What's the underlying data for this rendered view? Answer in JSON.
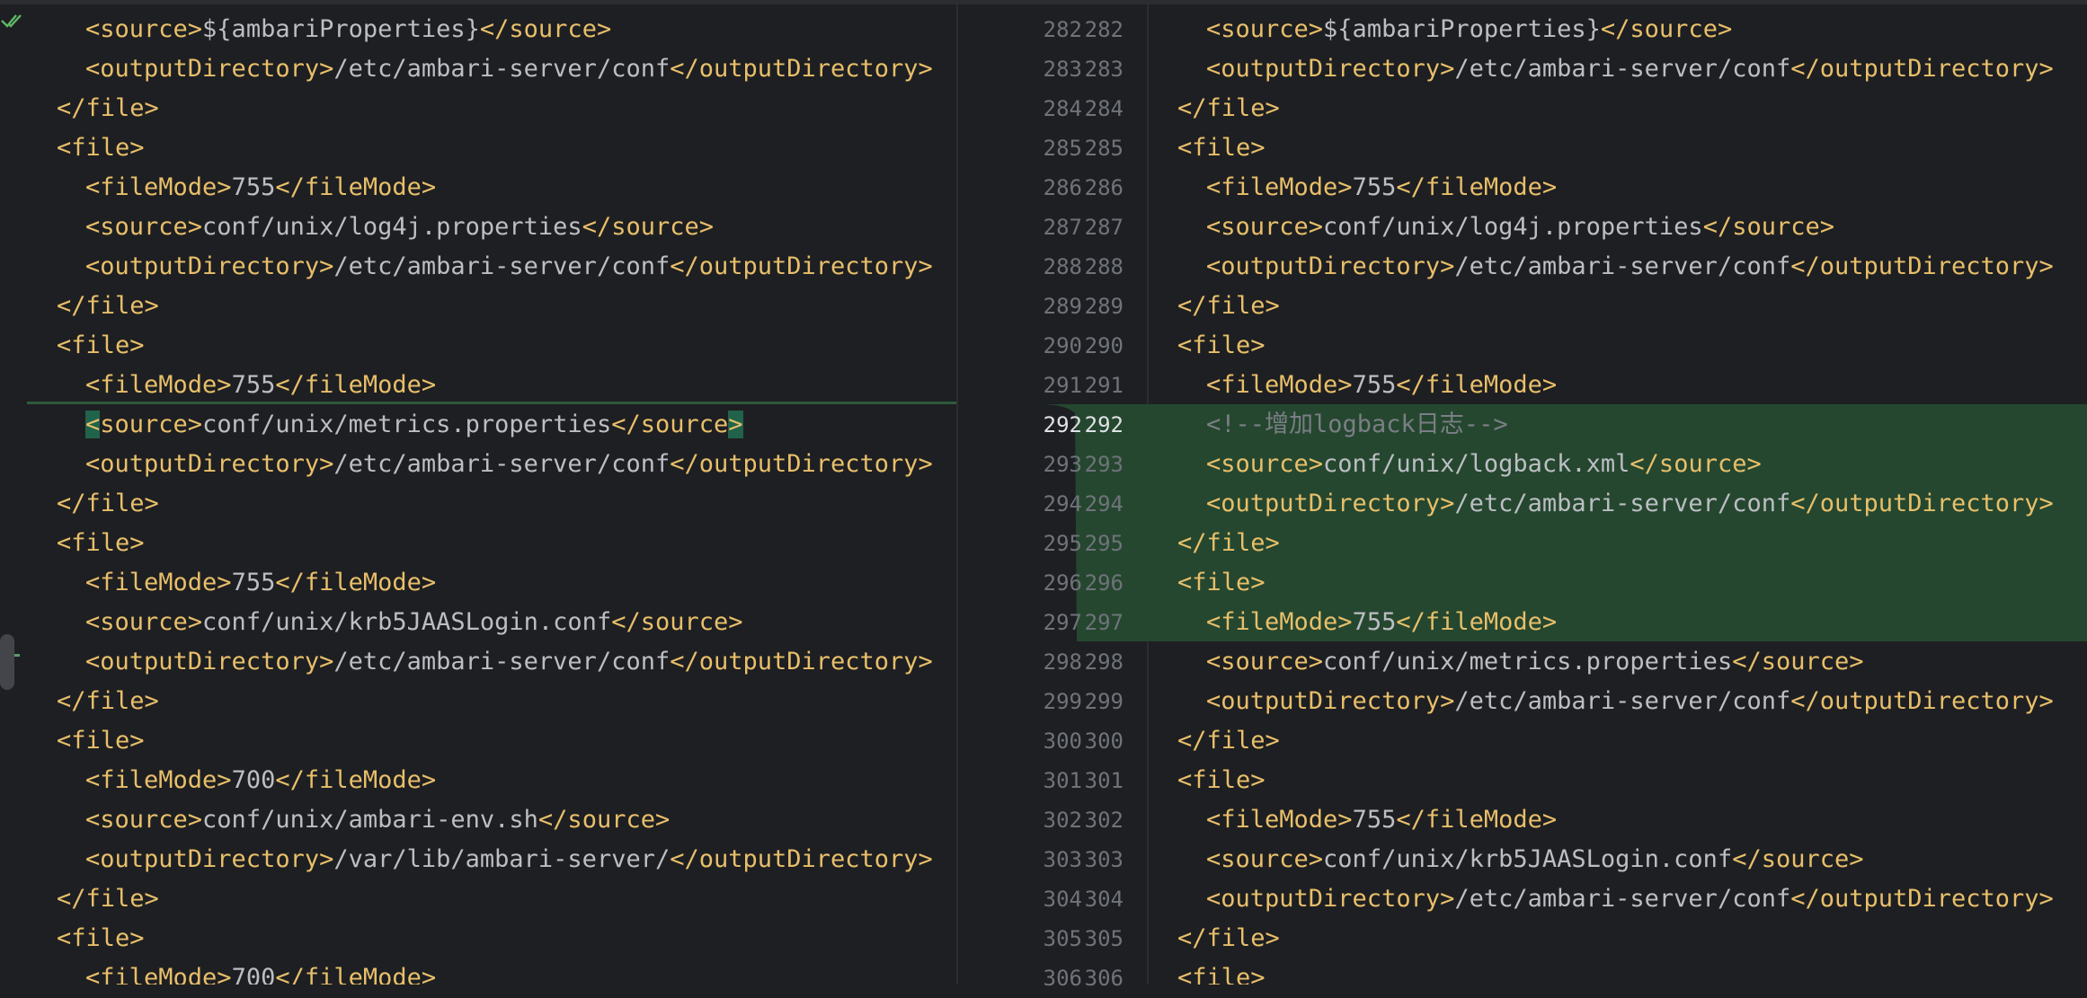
{
  "gutter": {
    "left_numbers": [
      "282",
      "283",
      "284",
      "285",
      "286",
      "287",
      "288",
      "289",
      "290",
      "291",
      "292",
      "293",
      "294",
      "295",
      "296",
      "297",
      "298",
      "299",
      "300",
      "301",
      "302",
      "303",
      "304",
      "305",
      "306"
    ],
    "right_numbers": [
      "282",
      "283",
      "284",
      "285",
      "286",
      "287",
      "288",
      "289",
      "290",
      "291",
      "292",
      "293",
      "294",
      "295",
      "296",
      "297",
      "298",
      "299",
      "300",
      "301",
      "302",
      "303",
      "304",
      "305",
      "306"
    ]
  },
  "left_pane": {
    "lines": [
      [
        {
          "t": "<source>",
          "c": "tag"
        },
        {
          "t": "${ambariProperties}",
          "c": "txt"
        },
        {
          "t": "</source>",
          "c": "tag"
        }
      ],
      [
        {
          "t": "<outputDirectory>",
          "c": "tag"
        },
        {
          "t": "/etc/ambari-server/conf",
          "c": "txt"
        },
        {
          "t": "</outputDirectory>",
          "c": "tag"
        }
      ],
      [
        {
          "t": "</file>",
          "c": "tag"
        }
      ],
      [
        {
          "t": "<file>",
          "c": "tag"
        }
      ],
      [
        {
          "t": "<fileMode>",
          "c": "tag"
        },
        {
          "t": "755",
          "c": "txt"
        },
        {
          "t": "</fileMode>",
          "c": "tag"
        }
      ],
      [
        {
          "t": "<source>",
          "c": "tag"
        },
        {
          "t": "conf/unix/log4j.properties",
          "c": "txt"
        },
        {
          "t": "</source>",
          "c": "tag"
        }
      ],
      [
        {
          "t": "<outputDirectory>",
          "c": "tag"
        },
        {
          "t": "/etc/ambari-server/conf",
          "c": "txt"
        },
        {
          "t": "</outputDirectory>",
          "c": "tag"
        }
      ],
      [
        {
          "t": "</file>",
          "c": "tag"
        }
      ],
      [
        {
          "t": "<file>",
          "c": "tag"
        }
      ],
      [
        {
          "t": "<fileMode>",
          "c": "tag"
        },
        {
          "t": "755",
          "c": "txt"
        },
        {
          "t": "</fileMode>",
          "c": "tag"
        }
      ],
      [
        {
          "t": "<",
          "c": "hl-tag"
        },
        {
          "t": "source>",
          "c": "tag"
        },
        {
          "t": "conf/unix/metrics.properties",
          "c": "txt"
        },
        {
          "t": "</source",
          "c": "tag"
        },
        {
          "t": ">",
          "c": "hl-tag"
        }
      ],
      [
        {
          "t": "<outputDirectory>",
          "c": "tag"
        },
        {
          "t": "/etc/ambari-server/conf",
          "c": "txt"
        },
        {
          "t": "</outputDirectory>",
          "c": "tag"
        }
      ],
      [
        {
          "t": "</file>",
          "c": "tag"
        }
      ],
      [
        {
          "t": "<file>",
          "c": "tag"
        }
      ],
      [
        {
          "t": "<fileMode>",
          "c": "tag"
        },
        {
          "t": "755",
          "c": "txt"
        },
        {
          "t": "</fileMode>",
          "c": "tag"
        }
      ],
      [
        {
          "t": "<source>",
          "c": "tag"
        },
        {
          "t": "conf/unix/krb5JAASLogin.conf",
          "c": "txt"
        },
        {
          "t": "</source>",
          "c": "tag"
        }
      ],
      [
        {
          "t": "<outputDirectory>",
          "c": "tag"
        },
        {
          "t": "/etc/ambari-server/conf",
          "c": "txt"
        },
        {
          "t": "</outputDirectory>",
          "c": "tag"
        }
      ],
      [
        {
          "t": "</file>",
          "c": "tag"
        }
      ],
      [
        {
          "t": "<file>",
          "c": "tag"
        }
      ],
      [
        {
          "t": "<fileMode>",
          "c": "tag"
        },
        {
          "t": "700",
          "c": "txt"
        },
        {
          "t": "</fileMode>",
          "c": "tag"
        }
      ],
      [
        {
          "t": "<source>",
          "c": "tag"
        },
        {
          "t": "conf/unix/ambari-env.sh",
          "c": "txt"
        },
        {
          "t": "</source>",
          "c": "tag"
        }
      ],
      [
        {
          "t": "<outputDirectory>",
          "c": "tag"
        },
        {
          "t": "/var/lib/ambari-server/",
          "c": "txt"
        },
        {
          "t": "</outputDirectory>",
          "c": "tag"
        }
      ],
      [
        {
          "t": "</file>",
          "c": "tag"
        }
      ],
      [
        {
          "t": "<file>",
          "c": "tag"
        }
      ],
      [
        {
          "t": "<fileMode>",
          "c": "tag"
        },
        {
          "t": "700",
          "c": "txt"
        },
        {
          "t": "</fileMode>",
          "c": "tag"
        }
      ]
    ],
    "indents": [
      2,
      2,
      1,
      1,
      2,
      2,
      2,
      1,
      1,
      2,
      2,
      2,
      1,
      1,
      2,
      2,
      2,
      1,
      1,
      2,
      2,
      2,
      1,
      1,
      2
    ]
  },
  "right_pane": {
    "lines": [
      [
        {
          "t": "<source>",
          "c": "tag"
        },
        {
          "t": "${ambariProperties}",
          "c": "txt"
        },
        {
          "t": "</source>",
          "c": "tag"
        }
      ],
      [
        {
          "t": "<outputDirectory>",
          "c": "tag"
        },
        {
          "t": "/etc/ambari-server/conf",
          "c": "txt"
        },
        {
          "t": "</outputDirectory>",
          "c": "tag"
        }
      ],
      [
        {
          "t": "</file>",
          "c": "tag"
        }
      ],
      [
        {
          "t": "<file>",
          "c": "tag"
        }
      ],
      [
        {
          "t": "<fileMode>",
          "c": "tag"
        },
        {
          "t": "755",
          "c": "txt"
        },
        {
          "t": "</fileMode>",
          "c": "tag"
        }
      ],
      [
        {
          "t": "<source>",
          "c": "tag"
        },
        {
          "t": "conf/unix/log4j.properties",
          "c": "txt"
        },
        {
          "t": "</source>",
          "c": "tag"
        }
      ],
      [
        {
          "t": "<outputDirectory>",
          "c": "tag"
        },
        {
          "t": "/etc/ambari-server/conf",
          "c": "txt"
        },
        {
          "t": "</outputDirectory>",
          "c": "tag"
        }
      ],
      [
        {
          "t": "</file>",
          "c": "tag"
        }
      ],
      [
        {
          "t": "<file>",
          "c": "tag"
        }
      ],
      [
        {
          "t": "<fileMode>",
          "c": "tag"
        },
        {
          "t": "755",
          "c": "txt"
        },
        {
          "t": "</fileMode>",
          "c": "tag"
        }
      ],
      [
        {
          "t": "<!--增加logback日志-->",
          "c": "cmt"
        }
      ],
      [
        {
          "t": "<source>",
          "c": "tag"
        },
        {
          "t": "conf/unix/logback.xml",
          "c": "txt"
        },
        {
          "t": "</source>",
          "c": "tag"
        }
      ],
      [
        {
          "t": "<outputDirectory>",
          "c": "tag"
        },
        {
          "t": "/etc/ambari-server/conf",
          "c": "txt"
        },
        {
          "t": "</outputDirectory>",
          "c": "tag"
        }
      ],
      [
        {
          "t": "</file>",
          "c": "tag"
        }
      ],
      [
        {
          "t": "<file>",
          "c": "tag"
        }
      ],
      [
        {
          "t": "<fileMode>",
          "c": "tag"
        },
        {
          "t": "755",
          "c": "txt"
        },
        {
          "t": "</fileMode>",
          "c": "tag"
        }
      ],
      [
        {
          "t": "<source>",
          "c": "tag"
        },
        {
          "t": "conf/unix/metrics.properties",
          "c": "txt"
        },
        {
          "t": "</source>",
          "c": "tag"
        }
      ],
      [
        {
          "t": "<outputDirectory>",
          "c": "tag"
        },
        {
          "t": "/etc/ambari-server/conf",
          "c": "txt"
        },
        {
          "t": "</outputDirectory>",
          "c": "tag"
        }
      ],
      [
        {
          "t": "</file>",
          "c": "tag"
        }
      ],
      [
        {
          "t": "<file>",
          "c": "tag"
        }
      ],
      [
        {
          "t": "<fileMode>",
          "c": "tag"
        },
        {
          "t": "755",
          "c": "txt"
        },
        {
          "t": "</fileMode>",
          "c": "tag"
        }
      ],
      [
        {
          "t": "<source>",
          "c": "tag"
        },
        {
          "t": "conf/unix/krb5JAASLogin.conf",
          "c": "txt"
        },
        {
          "t": "</source>",
          "c": "tag"
        }
      ],
      [
        {
          "t": "<outputDirectory>",
          "c": "tag"
        },
        {
          "t": "/etc/ambari-server/conf",
          "c": "txt"
        },
        {
          "t": "</outputDirectory>",
          "c": "tag"
        }
      ],
      [
        {
          "t": "</file>",
          "c": "tag"
        }
      ],
      [
        {
          "t": "<file>",
          "c": "tag"
        }
      ]
    ],
    "indents": [
      2,
      2,
      1,
      1,
      2,
      2,
      2,
      1,
      1,
      2,
      2,
      2,
      2,
      1,
      1,
      2,
      2,
      2,
      1,
      1,
      2,
      2,
      2,
      1,
      1
    ]
  },
  "colors": {
    "background": "#1e1f22",
    "tag": "#e8bf6a",
    "text": "#bcbec4",
    "comment": "#7a7e85",
    "added_block": "#25472f",
    "line_number": "#6f737a"
  },
  "icons": {
    "top_left": "double-check-icon"
  }
}
